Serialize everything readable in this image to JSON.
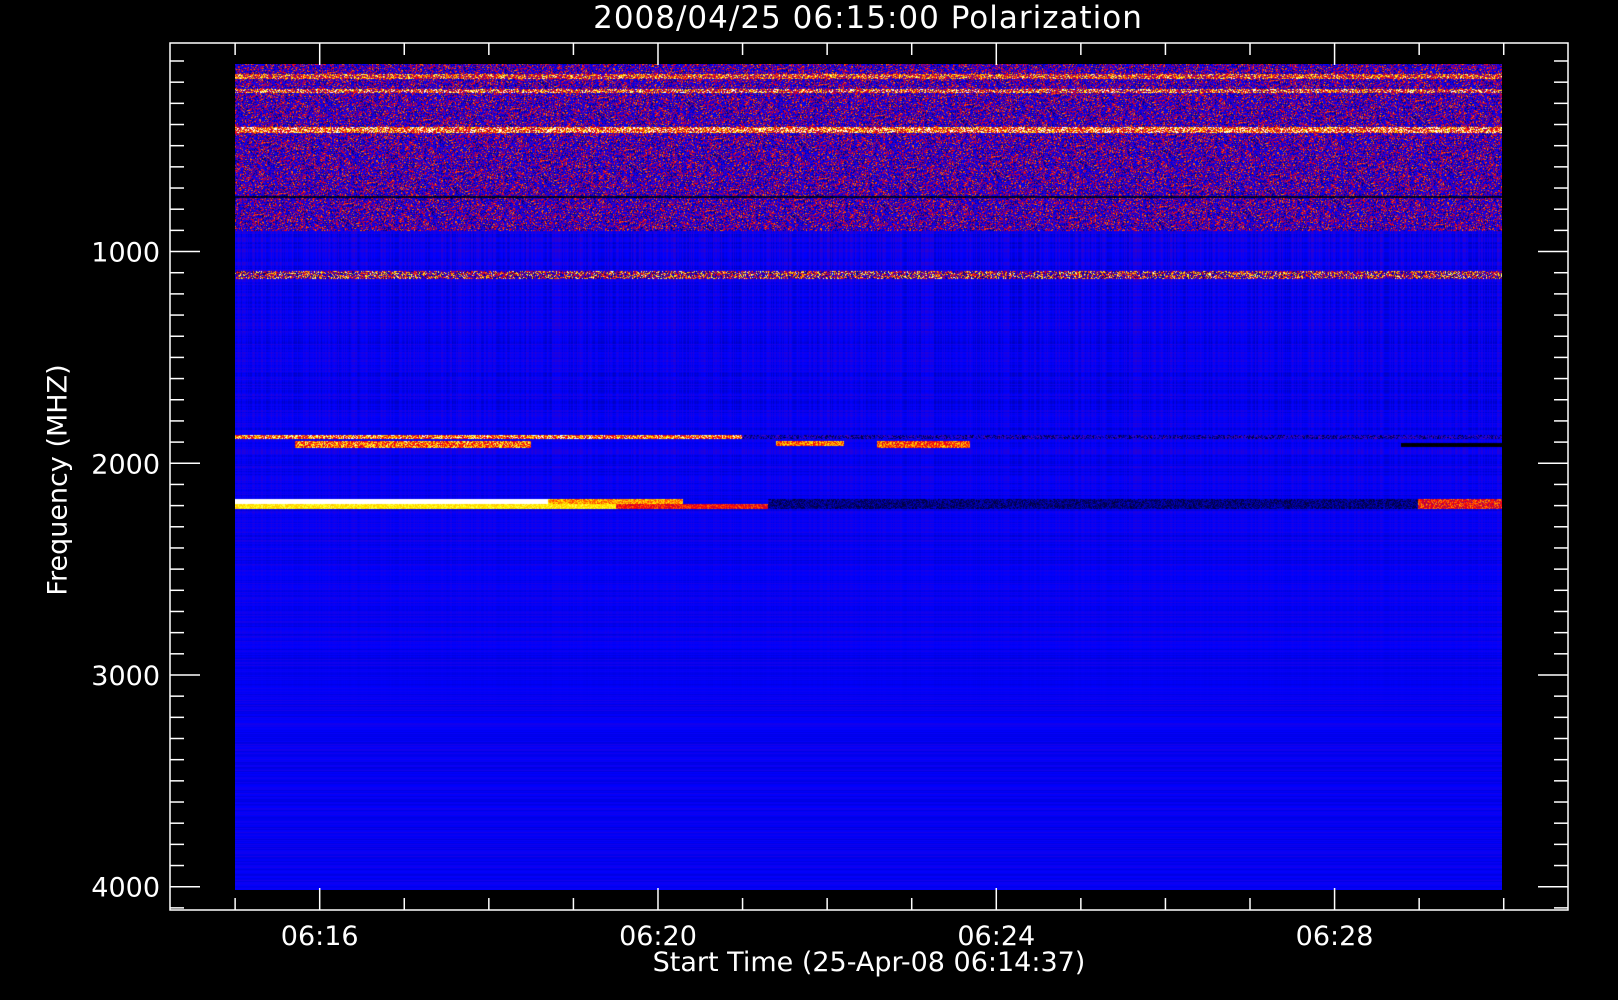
{
  "chart_data": {
    "type": "heatmap",
    "title": "2008/04/25 06:15:00 Polarization",
    "xlabel": "Start Time (25-Apr-08 06:14:37)",
    "ylabel": "Frequency (MHZ)",
    "x_unit": "minutes after 06:00 UT",
    "xlim": [
      14.23,
      30.76
    ],
    "data_time_range": [
      15.0,
      30.0
    ],
    "x_major_ticks": [
      16,
      20,
      24,
      28
    ],
    "x_tick_labels": [
      "06:16",
      "06:20",
      "06:24",
      "06:28"
    ],
    "x_minor_step": 1,
    "ylim": [
      15,
      4110
    ],
    "y_inverted": true,
    "data_freq_range": [
      115,
      4015
    ],
    "y_major_ticks": [
      1000,
      2000,
      3000,
      4000
    ],
    "y_tick_labels": [
      "1000",
      "2000",
      "3000",
      "4000"
    ],
    "y_minor_step": 100,
    "colormap": [
      "#000000",
      "#0000ff",
      "#7a0080",
      "#ff0000",
      "#ffa000",
      "#ffff00",
      "#ffffff"
    ],
    "background_level": 0.3,
    "features": [
      {
        "name": "noisy-low-band",
        "freq": [
          115,
          900
        ],
        "time": [
          15,
          30
        ],
        "level": 0.45,
        "noise": 0.35
      },
      {
        "name": "rfi-line-170",
        "freq": [
          160,
          185
        ],
        "time": [
          15,
          30
        ],
        "level": 0.7,
        "noise": 0.3
      },
      {
        "name": "rfi-line-240",
        "freq": [
          230,
          250
        ],
        "time": [
          15,
          30
        ],
        "level": 0.72,
        "noise": 0.35
      },
      {
        "name": "rfi-line-420",
        "freq": [
          410,
          440
        ],
        "time": [
          15,
          30
        ],
        "level": 0.8,
        "noise": 0.3
      },
      {
        "name": "dark-line-740",
        "freq": [
          735,
          745
        ],
        "time": [
          15,
          30
        ],
        "level": 0.05,
        "noise": 0.05
      },
      {
        "name": "spiky-1100",
        "freq": [
          1090,
          1130
        ],
        "time": [
          15,
          30
        ],
        "level": 0.55,
        "noise": 0.45
      },
      {
        "name": "band-1870",
        "freq": [
          1865,
          1885
        ],
        "time": [
          15,
          21
        ],
        "level": 0.8,
        "noise": 0.25
      },
      {
        "name": "band-1870-late",
        "freq": [
          1865,
          1885
        ],
        "time": [
          21,
          30
        ],
        "level": 0.25,
        "noise": 0.2
      },
      {
        "name": "band-1910",
        "freq": [
          1895,
          1925
        ],
        "time": [
          15.7,
          18.5
        ],
        "level": 0.78,
        "noise": 0.2
      },
      {
        "name": "burst-1910-a",
        "freq": [
          1895,
          1915
        ],
        "time": [
          21.4,
          22.2
        ],
        "level": 0.78,
        "noise": 0.15
      },
      {
        "name": "burst-1910-b",
        "freq": [
          1895,
          1925
        ],
        "time": [
          22.6,
          23.7
        ],
        "level": 0.75,
        "noise": 0.15
      },
      {
        "name": "dark-1920-late",
        "freq": [
          1900,
          1920
        ],
        "time": [
          28.8,
          30
        ],
        "level": 0.0,
        "noise": 0.02
      },
      {
        "name": "bright-2180-white",
        "freq": [
          2165,
          2190
        ],
        "time": [
          15,
          18.7
        ],
        "level": 1.0,
        "noise": 0.0
      },
      {
        "name": "bright-2180-fade",
        "freq": [
          2165,
          2190
        ],
        "time": [
          18.7,
          20.3
        ],
        "level": 0.82,
        "noise": 0.1
      },
      {
        "name": "bright-2210-yellow",
        "freq": [
          2190,
          2215
        ],
        "time": [
          15,
          19.5
        ],
        "level": 0.9,
        "noise": 0.05
      },
      {
        "name": "bright-2210-fade",
        "freq": [
          2190,
          2215
        ],
        "time": [
          19.5,
          21.3
        ],
        "level": 0.68,
        "noise": 0.1
      },
      {
        "name": "dark-2200-mid",
        "freq": [
          2165,
          2215
        ],
        "time": [
          21.3,
          29.0
        ],
        "level": 0.15,
        "noise": 0.1
      },
      {
        "name": "red-2200-late",
        "freq": [
          2165,
          2215
        ],
        "time": [
          29.0,
          30
        ],
        "level": 0.68,
        "noise": 0.15
      }
    ]
  }
}
